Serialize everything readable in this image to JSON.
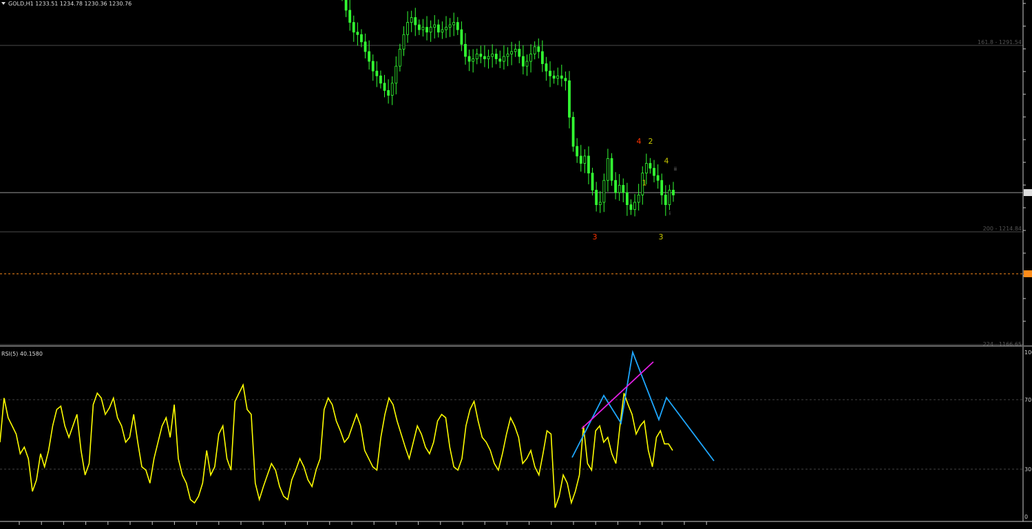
{
  "header": {
    "symbol_line": "GOLD,H1  1233.51 1234.78 1230.36 1230.76",
    "rsi_label": "RSI(5) 40.1580"
  },
  "colors": {
    "background": "#000000",
    "candle": "#33ff33",
    "rsi_line": "#ffff00",
    "trend_blue": "#1ea7ff",
    "trend_magenta": "#e31ee3",
    "wave_red": "#ff3300",
    "wave_yellow": "#c8c800",
    "fib_line": "#4d4d4d",
    "current_price_line": "#ff8c1a"
  },
  "chart_data": [
    {
      "type": "candlestick",
      "symbol": "GOLD",
      "timeframe": "H1",
      "ohlc_last": {
        "open": 1233.51,
        "high": 1234.78,
        "low": 1230.36,
        "close": 1230.76
      },
      "fib_levels": [
        {
          "label": "161.8 - 1291.54",
          "value": 1291.54
        },
        {
          "label": "200 - 1214.84",
          "value": 1214.84
        },
        {
          "label": "224 - 1166.65",
          "value": 1166.65
        }
      ],
      "ylim": [
        1166.65,
        1312
      ],
      "close_series": [
        1312,
        1306,
        1301,
        1297,
        1296,
        1293,
        1289,
        1285,
        1281,
        1279,
        1276,
        1273,
        1271,
        1276,
        1283,
        1290,
        1296,
        1301,
        1303,
        1300,
        1298,
        1299,
        1297,
        1299,
        1300,
        1297,
        1298,
        1299,
        1300,
        1301,
        1298,
        1292,
        1287,
        1285,
        1286,
        1288,
        1287,
        1286,
        1287,
        1288,
        1286,
        1285,
        1287,
        1288,
        1289,
        1290,
        1287,
        1283,
        1285,
        1288,
        1291,
        1289,
        1284,
        1281,
        1279,
        1278,
        1279,
        1278,
        1277,
        1262,
        1250,
        1246,
        1243,
        1246,
        1239,
        1232,
        1226,
        1227,
        1236,
        1245,
        1236,
        1231,
        1234,
        1231,
        1226,
        1224,
        1227,
        1230,
        1239,
        1243,
        1241,
        1238,
        1236,
        1230,
        1226,
        1232,
        1230
      ],
      "wave_labels": [
        {
          "text": "3",
          "color": "red",
          "price": 1218
        },
        {
          "text": "4",
          "color": "red",
          "price": 1251
        },
        {
          "text": "1",
          "color": "yellow",
          "price": 1234
        },
        {
          "text": "2",
          "color": "yellow",
          "price": 1251
        },
        {
          "text": "3",
          "color": "yellow",
          "price": 1218
        },
        {
          "text": "4",
          "color": "yellow",
          "price": 1243
        },
        {
          "text": "ii",
          "color": "gray",
          "price": 1240
        },
        {
          "text": "i",
          "color": "gray",
          "price": 1224
        }
      ],
      "current_price_line": 1196
    },
    {
      "type": "line",
      "name": "RSI(5)",
      "last_value": 40.158,
      "ylim": [
        0,
        100
      ],
      "levels": [
        30,
        70
      ],
      "tick_labels": [
        "100",
        "70",
        "30",
        "0"
      ],
      "values": [
        45,
        72,
        60,
        55,
        50,
        38,
        42,
        35,
        15,
        22,
        38,
        30,
        40,
        55,
        65,
        67,
        55,
        48,
        55,
        62,
        40,
        25,
        32,
        68,
        75,
        72,
        62,
        66,
        72,
        60,
        55,
        45,
        48,
        62,
        45,
        30,
        28,
        20,
        35,
        45,
        55,
        60,
        48,
        68,
        35,
        25,
        20,
        10,
        8,
        12,
        20,
        40,
        25,
        30,
        50,
        55,
        35,
        28,
        70,
        75,
        80,
        65,
        62,
        20,
        10,
        18,
        25,
        32,
        28,
        18,
        12,
        10,
        22,
        28,
        35,
        30,
        22,
        18,
        28,
        35,
        65,
        72,
        68,
        58,
        52,
        45,
        48,
        55,
        62,
        55,
        40,
        35,
        30,
        28,
        48,
        62,
        72,
        68,
        58,
        50,
        42,
        35,
        45,
        55,
        50,
        42,
        38,
        45,
        58,
        62,
        60,
        42,
        30,
        28,
        35,
        55,
        65,
        70,
        58,
        48,
        45,
        40,
        32,
        28,
        38,
        50,
        60,
        55,
        48,
        32,
        35,
        40,
        30,
        25,
        38,
        52,
        50,
        5,
        12,
        25,
        20,
        8,
        15,
        25,
        55,
        32,
        28,
        52,
        55,
        45,
        48,
        38,
        32,
        55,
        75,
        68,
        62,
        50,
        55,
        58,
        40,
        30,
        48,
        52,
        44,
        44,
        40
      ]
    }
  ],
  "trendlines": [
    {
      "name": "rsi-zigzag-blue",
      "color": "blue",
      "points": [
        [
          831,
          665
        ],
        [
          877,
          575
        ],
        [
          902,
          615
        ],
        [
          919,
          512
        ],
        [
          957,
          610
        ],
        [
          968,
          578
        ],
        [
          1037,
          670
        ]
      ]
    },
    {
      "name": "rsi-trend-magenta",
      "color": "magenta",
      "points": [
        [
          845,
          623
        ],
        [
          949,
          526
        ]
      ]
    }
  ]
}
